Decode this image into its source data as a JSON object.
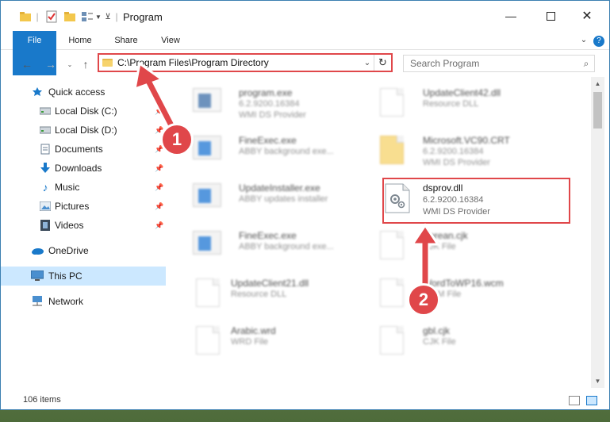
{
  "window": {
    "title": "Program",
    "controls": [
      "minimize",
      "maximize",
      "close"
    ]
  },
  "ribbon": {
    "tabs": [
      "File",
      "Home",
      "Share",
      "View"
    ]
  },
  "address_bar": {
    "path": "C:\\Program Files\\Program Directory"
  },
  "search": {
    "placeholder": "Search Program"
  },
  "sidebar": {
    "items": [
      {
        "label": "Quick access",
        "icon": "star-icon"
      },
      {
        "label": "Local Disk (C:)",
        "icon": "drive-icon"
      },
      {
        "label": "Local Disk (D:)",
        "icon": "drive-icon"
      },
      {
        "label": "Documents",
        "icon": "documents-icon"
      },
      {
        "label": "Downloads",
        "icon": "download-icon"
      },
      {
        "label": "Music",
        "icon": "music-icon"
      },
      {
        "label": "Pictures",
        "icon": "pictures-icon"
      },
      {
        "label": "Videos",
        "icon": "videos-icon"
      },
      {
        "label": "OneDrive",
        "icon": "cloud-icon"
      },
      {
        "label": "This PC",
        "icon": "computer-icon"
      },
      {
        "label": "Network",
        "icon": "network-icon"
      }
    ]
  },
  "files": [
    {
      "name": "program.exe",
      "line1": "6.2.9200.16384",
      "line2": "WMI DS Provider"
    },
    {
      "name": "UpdateClient42.dll",
      "line1": "Resource DLL",
      "line2": ""
    },
    {
      "name": "FineExec.exe",
      "line1": "ABBY background exe...",
      "line2": ""
    },
    {
      "name": "Microsoft.VC90.CRT",
      "line1": "6.2.9200.16384",
      "line2": "WMI DS Provider"
    },
    {
      "name": "UpdateInstaller.exe",
      "line1": "ABBY updates installer",
      "line2": ""
    },
    {
      "name": "dsprov.dll",
      "line1": "6.2.9200.16384",
      "line2": "WMI DS Provider"
    },
    {
      "name": "FineExec.exe",
      "line1": "ABBY background exe...",
      "line2": ""
    },
    {
      "name": "Korean.cjk",
      "line1": "CJK File",
      "line2": ""
    },
    {
      "name": "UpdateClient21.dll",
      "line1": "Resource DLL",
      "line2": ""
    },
    {
      "name": "WordToWP16.wcm",
      "line1": "WCM File",
      "line2": ""
    },
    {
      "name": "Arabic.wrd",
      "line1": "WRD File",
      "line2": ""
    },
    {
      "name": "gbl.cjk",
      "line1": "CJK File",
      "line2": ""
    }
  ],
  "status_bar": {
    "item_count": "106 items"
  },
  "annotations": {
    "badge1": "1",
    "badge2": "2",
    "highlight_color": "#e0474a"
  }
}
